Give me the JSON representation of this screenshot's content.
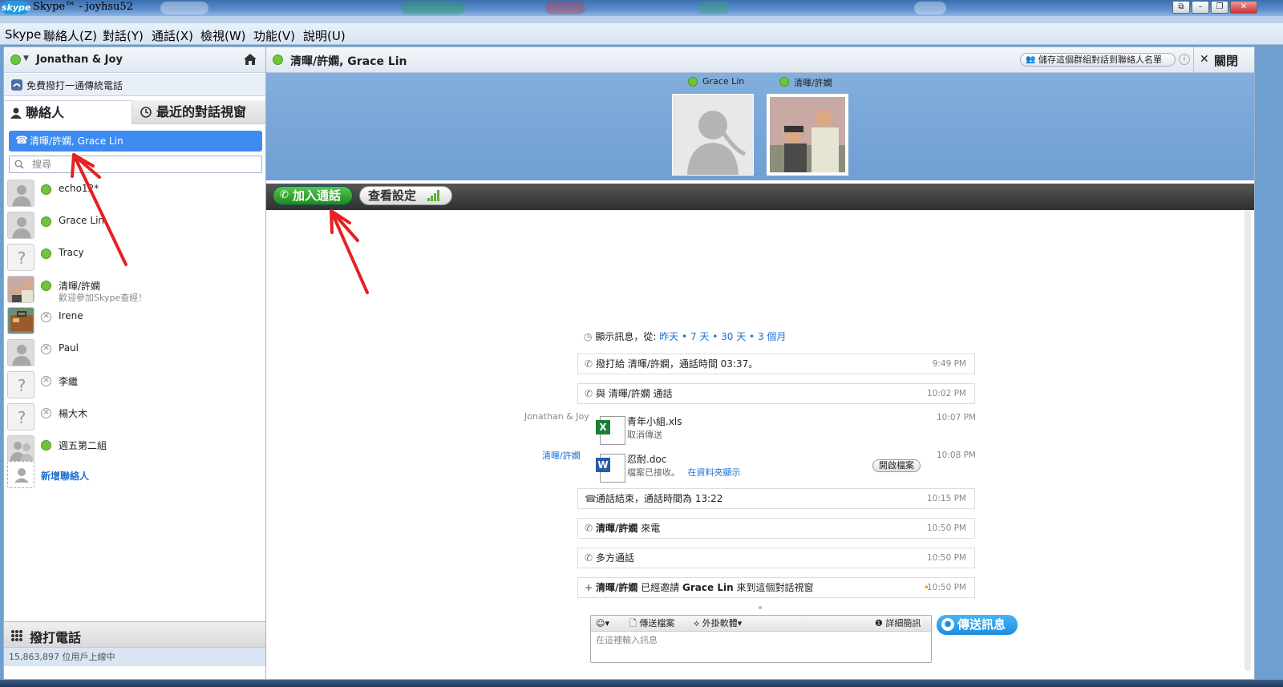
{
  "window": {
    "logo_text": "skype",
    "title": "Skype™ - joyhsu52",
    "controls": [
      "⧉",
      "–",
      "❐",
      "✕"
    ]
  },
  "menu": [
    "Skype",
    "聯絡人(Z)",
    "對話(Y)",
    "通話(X)",
    "檢視(W)",
    "功能(V)",
    "說明(U)"
  ],
  "sidebar": {
    "profile_name": "Jonathan & Joy",
    "free_call_label": "免費撥打一通傳統電話",
    "tabs": {
      "contacts": "聯絡人",
      "recent": "最近的對話視窗"
    },
    "selected_conversation": "清暉/許嫻, Grace Lin",
    "search_placeholder": "搜尋",
    "contacts": [
      {
        "name": "echo12*",
        "mood": "",
        "status": "online",
        "avatar": "default"
      },
      {
        "name": "Grace Lin",
        "mood": "",
        "status": "online",
        "avatar": "default"
      },
      {
        "name": "Tracy",
        "mood": "",
        "status": "online",
        "avatar": "unknown"
      },
      {
        "name": "清暉/許嫻",
        "mood": "歡迎參加Skype查經！",
        "status": "online",
        "avatar": "photo"
      },
      {
        "name": "Irene",
        "mood": "",
        "status": "offline",
        "avatar": "suitcase"
      },
      {
        "name": "Paul",
        "mood": "",
        "status": "offline",
        "avatar": "default"
      },
      {
        "name": "李繼",
        "mood": "",
        "status": "offline",
        "avatar": "unknown"
      },
      {
        "name": "楊大木",
        "mood": "",
        "status": "offline",
        "avatar": "unknown"
      },
      {
        "name": "週五第二組",
        "mood": "",
        "status": "group",
        "avatar": "group"
      }
    ],
    "add_contact": "新增聯絡人",
    "call_phones": "撥打電話",
    "online_count": "15,863,897 位用戶上線中"
  },
  "conversation": {
    "title": "清暉/許嫻, Grace Lin",
    "save_group": "儲存這個群組對話到聯絡人名單",
    "close": "關閉",
    "participants": [
      {
        "name": "Grace Lin",
        "avatar": "default"
      },
      {
        "name": "清暉/許嫻",
        "avatar": "photo"
      }
    ],
    "join_call": "加入通話",
    "view_settings": "查看設定",
    "history": {
      "label": "顯示訊息，從:",
      "options": [
        "昨天",
        "7 天",
        "30 天",
        "3 個月"
      ],
      "separator": "•"
    },
    "events": [
      {
        "text": "撥打給 清暉/許嫻，通話時間 03:37。",
        "time": "9:49 PM"
      },
      {
        "text": "與 清暉/許嫻 通話",
        "time": "10:02 PM"
      },
      {
        "text": "通話結束，通話時間為 13:22",
        "time": "10:15 PM"
      },
      {
        "bold": "清暉/許嫻",
        "text": " 來電",
        "time": "10:50 PM"
      },
      {
        "text": "多方通話",
        "time": "10:50 PM"
      },
      {
        "bold": "清暉/許嫻",
        "text": " 已經邀請 ",
        "bold2": "Grace Lin",
        "text2": " 來到這個對話視窗",
        "time": "10:50 PM"
      }
    ],
    "files": [
      {
        "sender": "Jonathan & Joy",
        "name": "青年小組.xls",
        "status": "取消傳送",
        "time": "10:07 PM",
        "type": "excel"
      },
      {
        "sender": "清暉/許嫻",
        "name": "忍耐.doc",
        "status": "檔案已接收。",
        "link": "在資料夾顯示",
        "button": "開啟檔案",
        "time": "10:08 PM",
        "type": "word"
      }
    ],
    "composer": {
      "emoticon": "☺▾",
      "send_file": "傳送檔案",
      "plugins": "外掛軟體",
      "profile": "詳細簡訊",
      "placeholder": "在這裡輸入訊息",
      "send": "傳送訊息"
    }
  },
  "colors": {
    "accent": "#3d8bf0",
    "online": "#6fc43a",
    "join_call": "#2e9a2a",
    "annotation": "#e82020"
  }
}
